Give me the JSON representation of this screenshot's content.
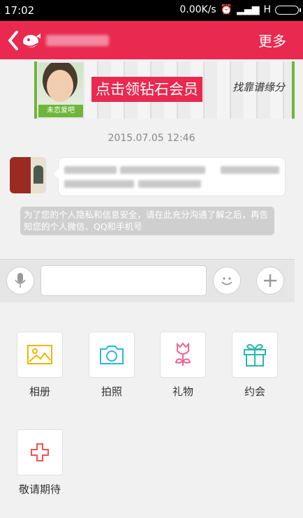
{
  "status_bar": {
    "time": "17:02",
    "speed": "0.00K/s",
    "network": "H"
  },
  "header": {
    "more_label": "更多",
    "accent": "#e9294f"
  },
  "banner": {
    "photo_tag": "未恋爱吧",
    "headline": "点击领钻石会员",
    "script_text": "找靠谱缘分"
  },
  "chat": {
    "timestamp": "2015.07.05 12:46",
    "notice": "为了您的个人隐私和信息安全，请在此充分沟通了解之后，再告知您的个人微信、QQ和手机号"
  },
  "input": {
    "value": "",
    "placeholder": ""
  },
  "tools": [
    {
      "label": "相册",
      "icon": "photo-album-icon",
      "color": "#f5b400"
    },
    {
      "label": "拍照",
      "icon": "camera-icon",
      "color": "#29b6e6"
    },
    {
      "label": "礼物",
      "icon": "rose-icon",
      "color": "#f06292"
    },
    {
      "label": "约会",
      "icon": "gift-box-icon",
      "color": "#29b6b0"
    },
    {
      "label": "敬请期待",
      "icon": "plus-icon",
      "color": "#ef5350"
    }
  ]
}
